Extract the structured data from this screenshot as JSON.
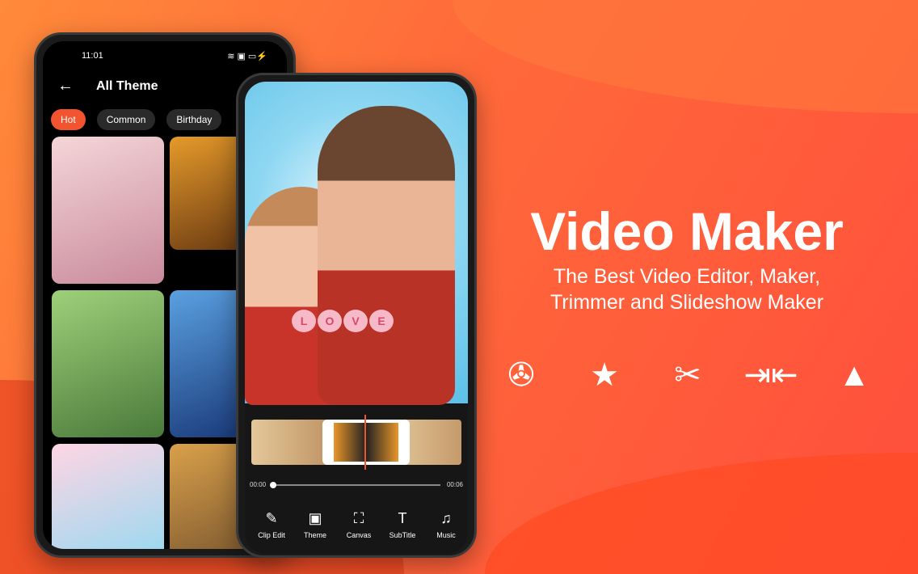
{
  "left_phone": {
    "status_time": "11:01",
    "title": "All Theme",
    "tabs": [
      {
        "label": "Hot",
        "active": true
      },
      {
        "label": "Common",
        "active": false
      },
      {
        "label": "Birthday",
        "active": false
      }
    ],
    "tiles": [
      {
        "colors": [
          "#f4d6d8",
          "#c98a9c"
        ]
      },
      {
        "colors": [
          "#e59a2a",
          "#6a3a12"
        ]
      },
      {
        "colors": [
          "#9ed07a",
          "#4a7a3a"
        ]
      },
      {
        "colors": [
          "#5aa0e0",
          "#1a3a7a"
        ]
      },
      {
        "colors": [
          "#ffd6e4",
          "#9ad8f0"
        ]
      },
      {
        "colors": [
          "#d9a04a",
          "#6a4a2a"
        ]
      }
    ]
  },
  "editor": {
    "love_letters": [
      "L",
      "O",
      "V",
      "E"
    ],
    "time_start": "00:00",
    "time_end": "00:06",
    "tools": [
      {
        "label": "Clip Edit",
        "icon": "✎"
      },
      {
        "label": "Theme",
        "icon": "▣"
      },
      {
        "label": "Canvas",
        "icon": "⛶"
      },
      {
        "label": "SubTitle",
        "icon": "T"
      },
      {
        "label": "Music",
        "icon": "♫"
      }
    ]
  },
  "promo": {
    "headline": "Video Maker",
    "subline1": "The Best Video Editor, Maker,",
    "subline2": "Trimmer and Slideshow Maker",
    "features": [
      {
        "icon": "film-reel-icon",
        "glyph": "✇"
      },
      {
        "icon": "theme-star-icon",
        "glyph": "★"
      },
      {
        "icon": "film-cut-icon",
        "glyph": "✂"
      },
      {
        "icon": "merge-icon",
        "glyph": "⇥⇤"
      },
      {
        "icon": "image-icon",
        "glyph": "▲"
      }
    ]
  },
  "colors": {
    "accent": "#f1542f"
  }
}
